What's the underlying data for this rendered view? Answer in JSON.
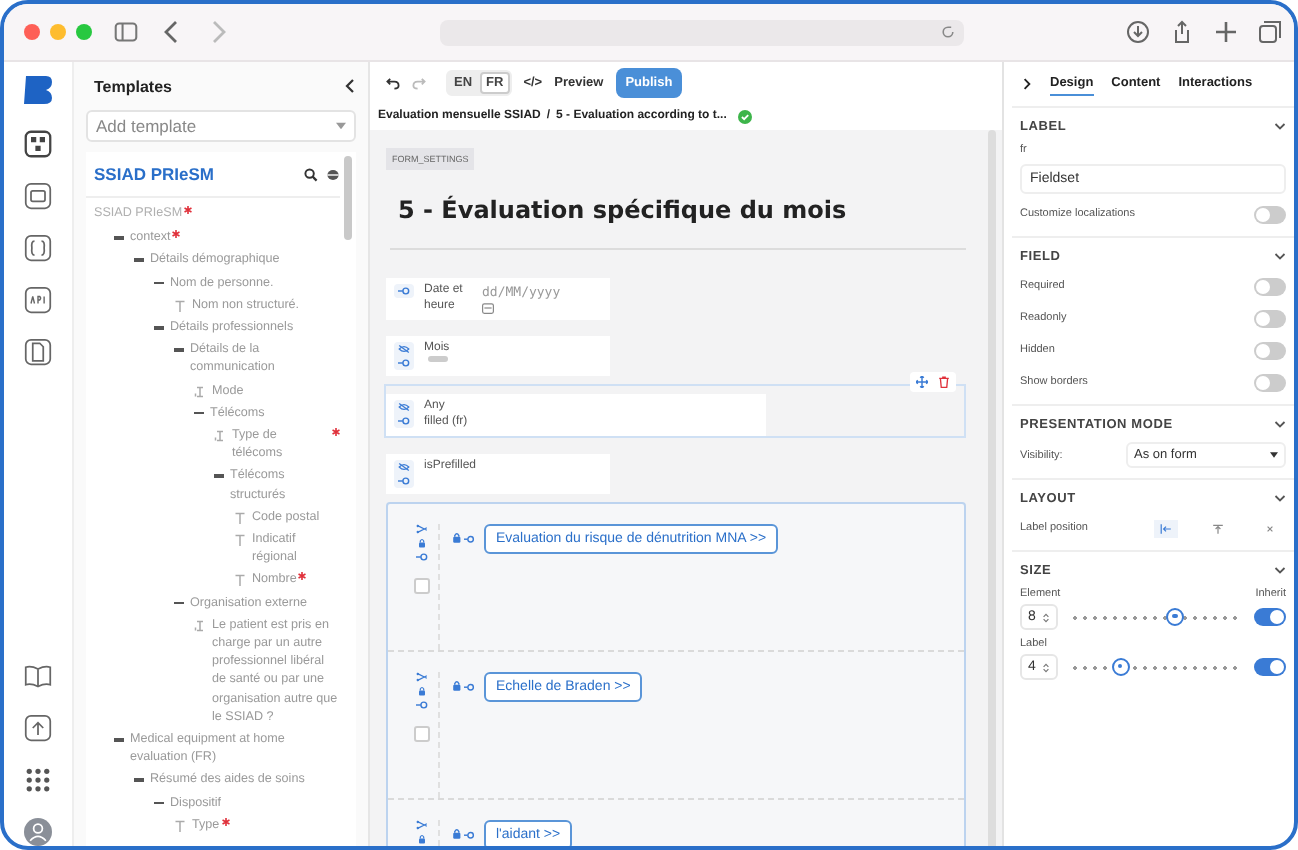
{
  "templates_panel": {
    "title": "Templates",
    "add_placeholder": "Add template",
    "template_name": "SSIAD PRIeSM",
    "tree": [
      {
        "label": "SSIAD PRIeSM",
        "kind": "root",
        "required": true,
        "children": [
          {
            "label": "context",
            "kind": "group",
            "required": true,
            "children": [
              {
                "label": "Détails démographique",
                "kind": "group",
                "required": false,
                "children": [
                  {
                    "label": "Nom de personne.",
                    "kind": "group",
                    "required": false,
                    "children": [
                      {
                        "label": "Nom non structuré.",
                        "kind": "text",
                        "required": false
                      }
                    ]
                  },
                  {
                    "label": "Détails professionnels",
                    "kind": "group",
                    "required": false,
                    "children": [
                      {
                        "label": "Détails de la communication",
                        "kind": "group",
                        "required": false,
                        "children": [
                          {
                            "label": "Mode",
                            "kind": "coded",
                            "required": false
                          },
                          {
                            "label": "Télécoms",
                            "kind": "group",
                            "required": false,
                            "children": [
                              {
                                "label": "Type de télécoms",
                                "kind": "coded",
                                "required": true
                              },
                              {
                                "label": "Télécoms structurés",
                                "kind": "group",
                                "required": false,
                                "children": [
                                  {
                                    "label": "Code postal",
                                    "kind": "text",
                                    "required": false
                                  },
                                  {
                                    "label": "Indicatif régional",
                                    "kind": "text",
                                    "required": false
                                  },
                                  {
                                    "label": "Nombre",
                                    "kind": "text",
                                    "required": true
                                  }
                                ]
                              }
                            ]
                          }
                        ]
                      },
                      {
                        "label": "Organisation externe",
                        "kind": "group",
                        "required": false,
                        "children": [
                          {
                            "label": "Le patient est pris en charge par un autre professionnel libéral de santé ou par une organisation autre que le SSIAD ?",
                            "kind": "coded",
                            "required": false
                          }
                        ]
                      }
                    ]
                  }
                ]
              }
            ]
          },
          {
            "label": "Medical equipment at home evaluation (FR)",
            "kind": "group",
            "required": false,
            "children": [
              {
                "label": "Résumé des aides de soins",
                "kind": "group",
                "required": false,
                "children": [
                  {
                    "label": "Dispositif",
                    "kind": "group",
                    "required": false,
                    "children": [
                      {
                        "label": "Type",
                        "kind": "text",
                        "required": true
                      }
                    ]
                  }
                ]
              }
            ]
          }
        ]
      }
    ]
  },
  "toolbar": {
    "languages": [
      {
        "label": "EN",
        "selected": false
      },
      {
        "label": "FR",
        "selected": true
      }
    ],
    "code_label": "</>",
    "preview": "Preview",
    "publish": "Publish"
  },
  "breadcrumb": {
    "form": "Evaluation mensuelle SSIAD",
    "separator": "/",
    "section": "5 - Evaluation according to t..."
  },
  "form": {
    "settings_tag": "FORM_SETTINGS",
    "title": "5 - Évaluation spécifique du mois",
    "fields": [
      {
        "label": "Date et heure",
        "kind": "date",
        "hidden": false,
        "selected": false,
        "placeholder": "dd/MM/yyyy"
      },
      {
        "label": "Mois",
        "kind": "select",
        "hidden": true,
        "selected": false
      },
      {
        "label": "Any filled (fr)",
        "kind": "plain",
        "hidden": true,
        "selected": true
      },
      {
        "label": "isPrefilled",
        "kind": "plain",
        "hidden": true,
        "selected": false
      }
    ],
    "group_rows": [
      {
        "button": "Evaluation du risque de dénutrition MNA >>",
        "checked": false
      },
      {
        "button": "Echelle de Braden >>",
        "checked": false
      },
      {
        "button": "l'aidant >>"
      }
    ]
  },
  "properties": {
    "tabs": [
      {
        "label": "Design",
        "selected": true
      },
      {
        "label": "Content",
        "selected": false
      },
      {
        "label": "Interactions",
        "selected": false
      }
    ],
    "label_section": {
      "title": "LABEL",
      "expanded": true,
      "lang": "fr",
      "value": "Fieldset",
      "customize": "Customize localizations",
      "customize_on": false
    },
    "field_section": {
      "title": "FIELD",
      "expanded": true,
      "toggles": [
        {
          "label": "Required",
          "on": false
        },
        {
          "label": "Readonly",
          "on": false
        },
        {
          "label": "Hidden",
          "on": false
        },
        {
          "label": "Show borders",
          "on": false
        }
      ]
    },
    "presentation_section": {
      "title": "PRESENTATION MODE",
      "expanded": true,
      "visibility_label": "Visibility:",
      "visibility_value": "As on form"
    },
    "layout_section": {
      "title": "LAYOUT",
      "expanded": true,
      "label_position": "Label position",
      "positions": [
        {
          "kind": "left",
          "selected": true
        },
        {
          "kind": "top",
          "selected": false
        },
        {
          "kind": "none",
          "selected": false
        }
      ]
    },
    "size_section": {
      "title": "SIZE",
      "expanded": true,
      "inherit": "Inherit",
      "sizes": [
        {
          "label": "Element",
          "value": "8",
          "level": 0.62,
          "inherit_on": true
        },
        {
          "label": "Label",
          "value": "4",
          "level": 0.3,
          "inherit_on": true
        }
      ]
    }
  }
}
